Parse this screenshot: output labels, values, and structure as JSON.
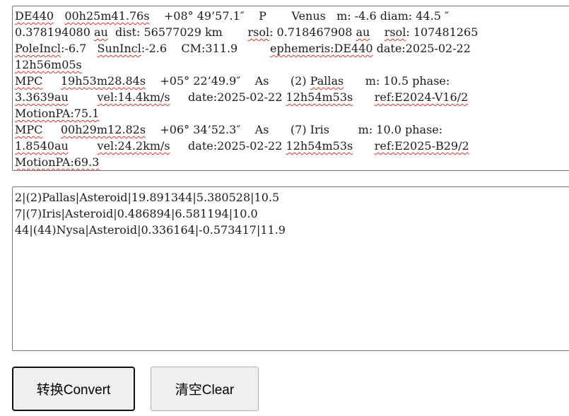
{
  "input": {
    "lines": [
      [
        {
          "t": "DE440",
          "s": 1
        },
        {
          "t": "   "
        },
        {
          "t": "00h25m41.76s",
          "s": 1
        },
        {
          "t": "    +08° 49’57.1″    P       Venus   m: -4.6 diam: 44.5 ″"
        }
      ],
      [
        {
          "t": "0.378194080 "
        },
        {
          "t": "au",
          "s": 1
        },
        {
          "t": "  dist: 56577029 km       "
        },
        {
          "t": "rsol",
          "s": 1
        },
        {
          "t": ": 0.718467908 "
        },
        {
          "t": "au",
          "s": 1
        },
        {
          "t": "    "
        },
        {
          "t": "rsol",
          "s": 1
        },
        {
          "t": ": 107481265"
        }
      ],
      [
        {
          "t": "PoleIncl",
          "s": 1
        },
        {
          "t": ":-6.7   "
        },
        {
          "t": "SunIncl",
          "s": 1
        },
        {
          "t": ":-2.6    CM:311.9         "
        },
        {
          "t": "ephemeris:DE440",
          "s": 1
        },
        {
          "t": " date:2025-02-22"
        }
      ],
      [
        {
          "t": "12h56m05s",
          "s": 1
        }
      ],
      [
        {
          "t": "MPC",
          "s": 1
        },
        {
          "t": "     "
        },
        {
          "t": "19h53m28.84s",
          "s": 1
        },
        {
          "t": "    +05° 22’49.9″    As      (2) "
        },
        {
          "t": "Pallas",
          "s": 1
        },
        {
          "t": "      m: 10.5 phase:"
        }
      ],
      [
        {
          "t": "3.3639au",
          "s": 1
        },
        {
          "t": "        "
        },
        {
          "t": "vel:14.4km/s",
          "s": 1
        },
        {
          "t": "     date:2025-02-22 "
        },
        {
          "t": "12h54m53s",
          "s": 1
        },
        {
          "t": "      "
        },
        {
          "t": "ref:E2024-V16/2",
          "s": 1
        }
      ],
      [
        {
          "t": "MotionPA:75.1",
          "s": 1
        }
      ],
      [
        {
          "t": "MPC",
          "s": 1
        },
        {
          "t": "     "
        },
        {
          "t": "00h29m12.82s",
          "s": 1
        },
        {
          "t": "    +06° 34’52.3″    As      (7) Iris        m: 10.0 phase:"
        }
      ],
      [
        {
          "t": "1.8540au",
          "s": 1
        },
        {
          "t": "        "
        },
        {
          "t": "vel:24.2km/s",
          "s": 1
        },
        {
          "t": "     date:2025-02-22 "
        },
        {
          "t": "12h54m53s",
          "s": 1
        },
        {
          "t": "      "
        },
        {
          "t": "ref:E2025-B29/2",
          "s": 1
        }
      ],
      [
        {
          "t": "MotionPA:69.3",
          "s": 1
        }
      ]
    ]
  },
  "output": {
    "lines": [
      "2|(2)Pallas|Asteroid|19.891344|5.380528|10.5",
      "7|(7)Iris|Asteroid|0.486894|6.581194|10.0",
      "44|(44)Nysa|Asteroid|0.336164|-0.573417|11.9"
    ]
  },
  "buttons": {
    "convert_label": "转换Convert",
    "clear_label": "清空Clear"
  },
  "colors": {
    "spellcheck_underline": "#e0302a",
    "button_background": "#efefef",
    "border": "#767676"
  }
}
